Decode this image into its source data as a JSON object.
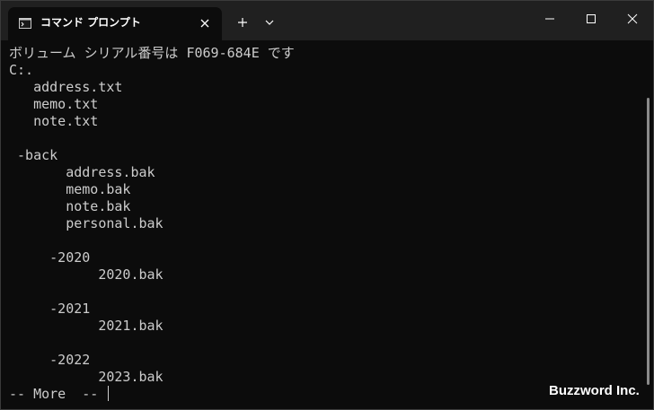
{
  "window": {
    "tab_title": "コマンド プロンプト",
    "tab_icon": "cmd-icon"
  },
  "terminal": {
    "lines": [
      "ボリューム シリアル番号は F069-684E です",
      "C:.",
      "   address.txt",
      "   memo.txt",
      "   note.txt",
      "",
      " -back",
      "       address.bak",
      "       memo.bak",
      "       note.bak",
      "       personal.bak",
      "",
      "     -2020",
      "           2020.bak",
      "",
      "     -2021",
      "           2021.bak",
      "",
      "     -2022",
      "           2023.bak"
    ],
    "prompt": "-- More  -- "
  },
  "watermark": "Buzzword Inc.",
  "colors": {
    "background": "#0c0c0c",
    "titlebar": "#202020",
    "text": "#cccccc"
  }
}
